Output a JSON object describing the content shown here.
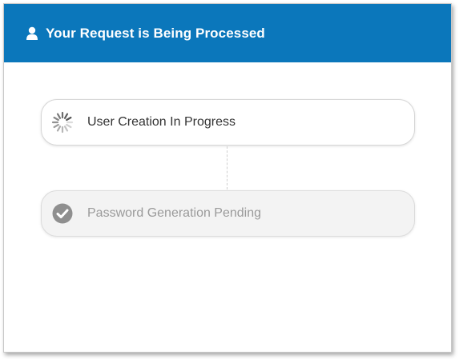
{
  "header": {
    "title": "Your Request is Being Processed",
    "icon": "user-icon",
    "background": "#0b77bb"
  },
  "steps": [
    {
      "label": "User Creation In Progress",
      "status": "in-progress",
      "icon": "spinner-icon"
    },
    {
      "label": "Password Generation Pending",
      "status": "pending",
      "icon": "check-circle-icon"
    }
  ]
}
